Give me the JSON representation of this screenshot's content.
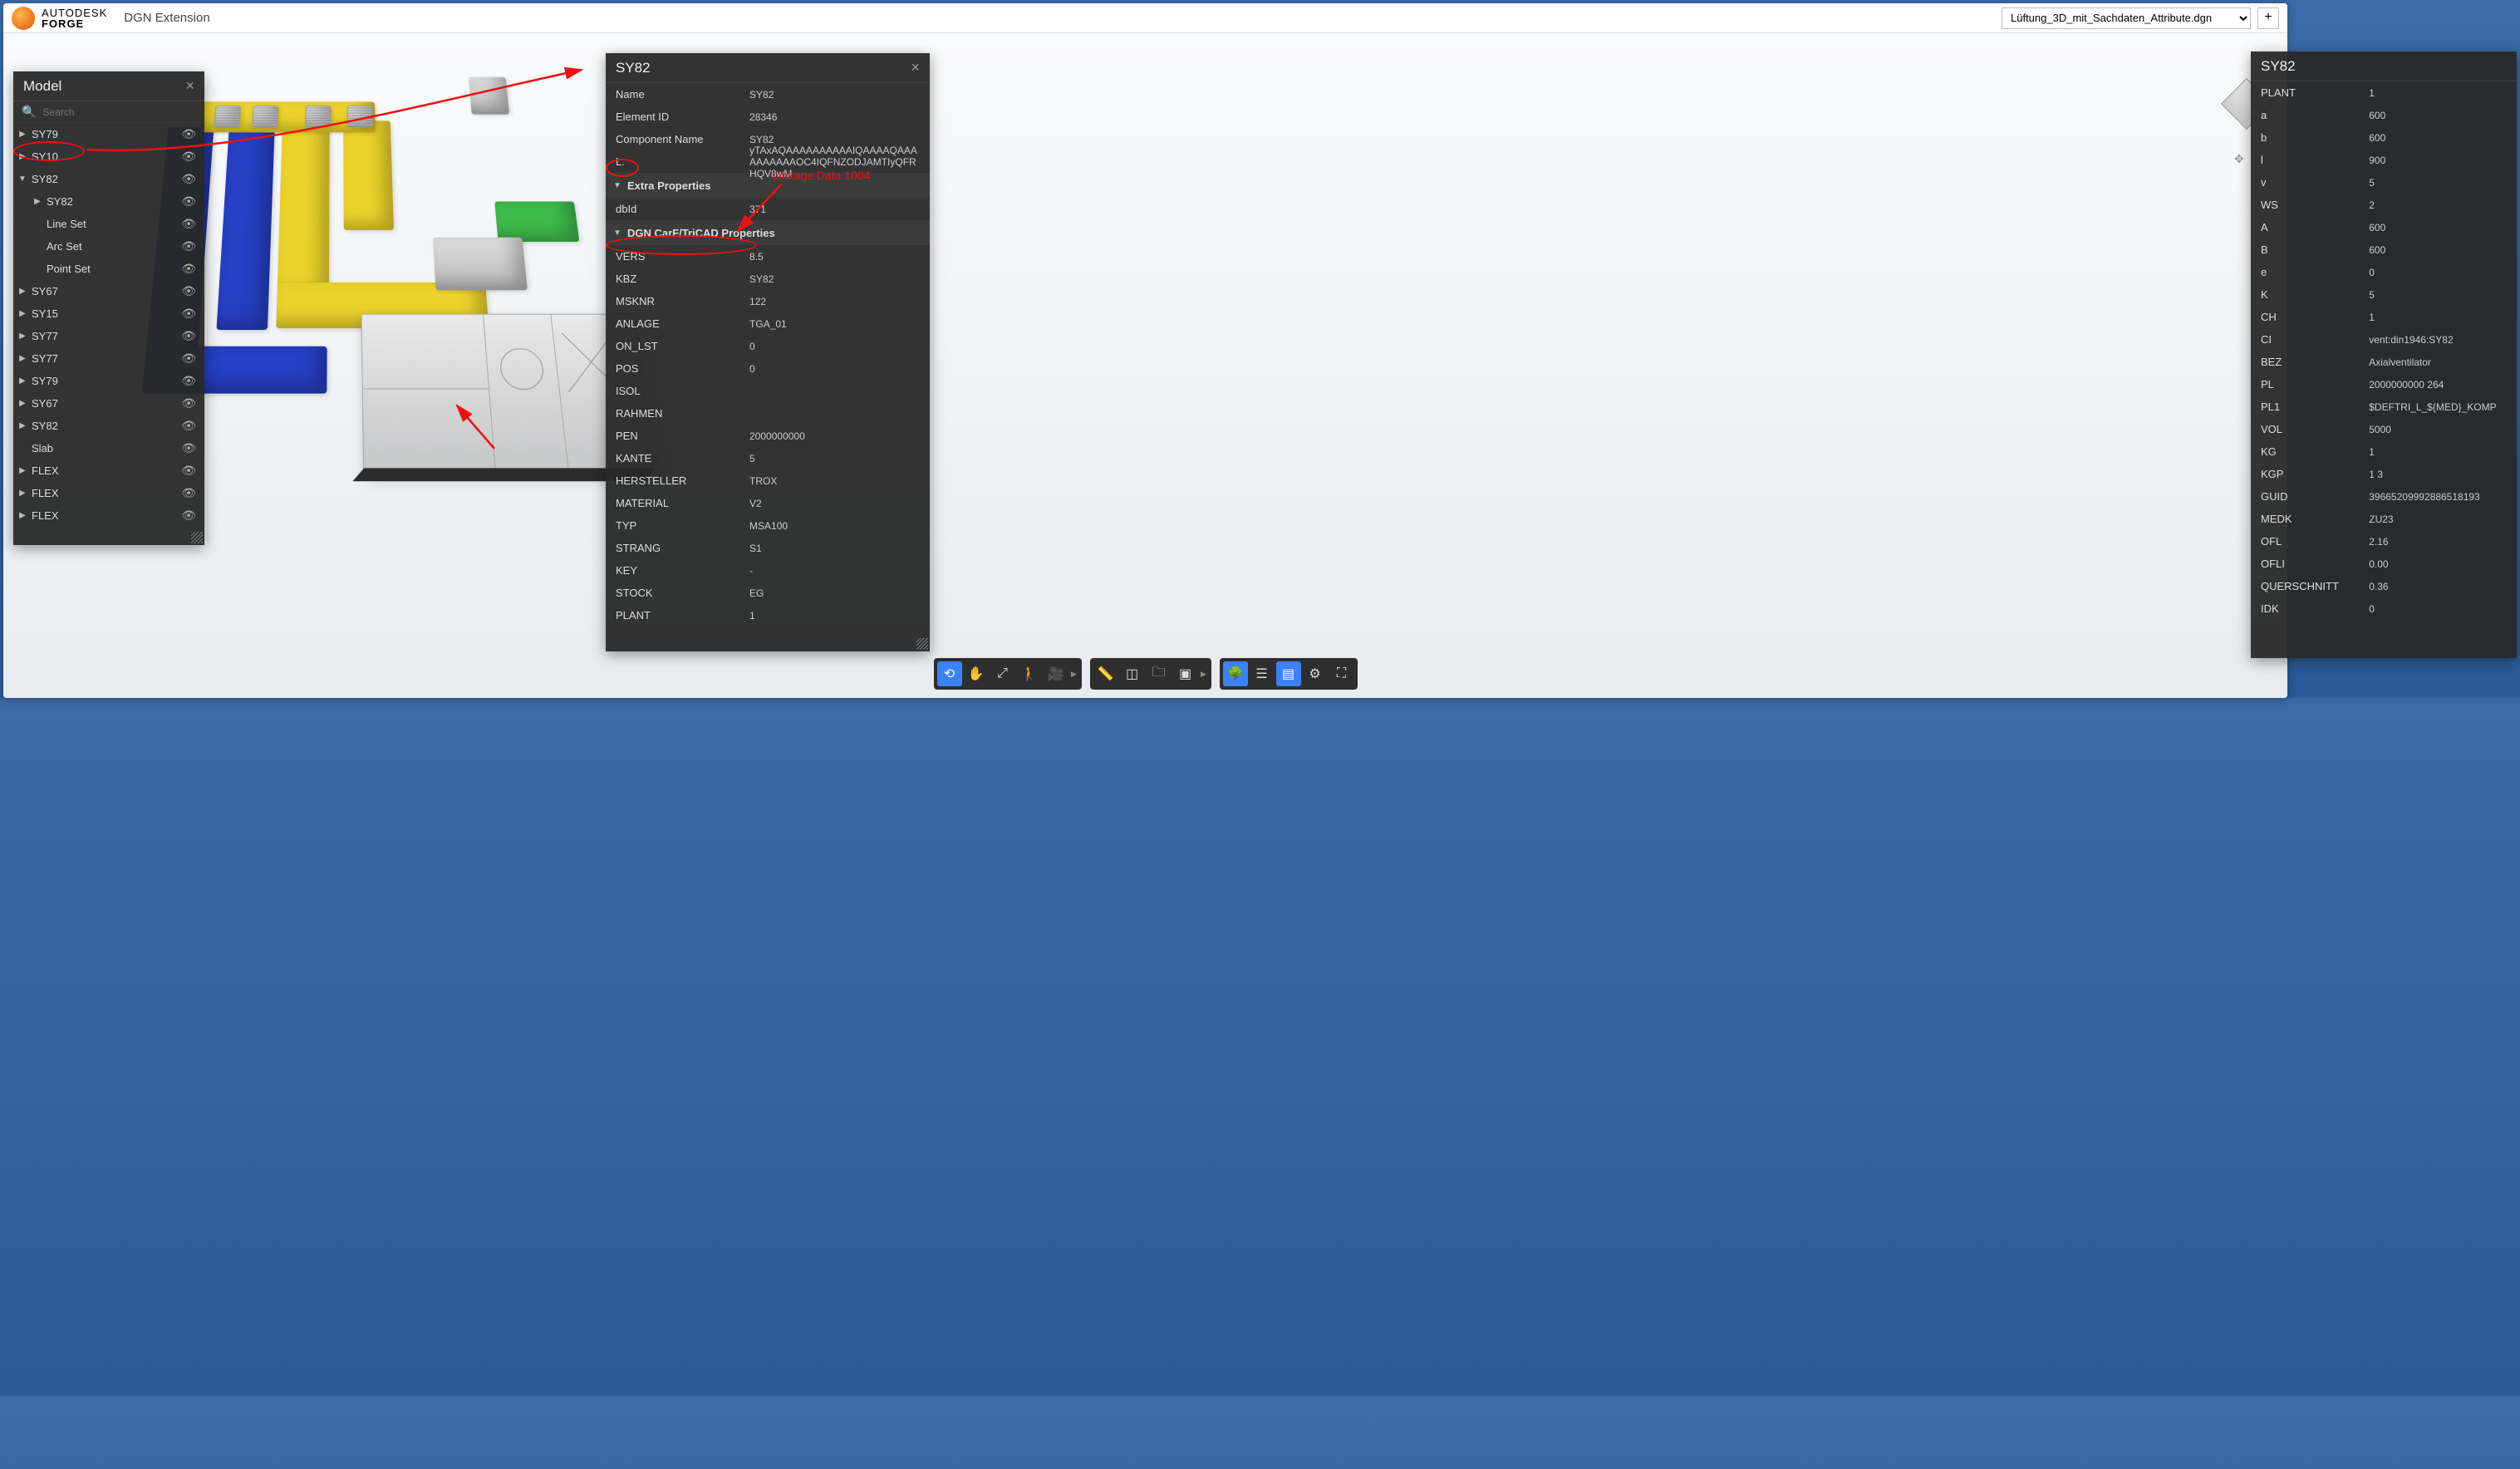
{
  "header": {
    "brand_top": "AUTODESK",
    "brand_bottom": "FORGE",
    "app_title": "DGN Extension",
    "file_selected": "Lüftung_3D_mit_Sachdaten_Attribute.dgn",
    "plus": "+"
  },
  "model_panel": {
    "title": "Model",
    "search_placeholder": "Search",
    "tree": [
      {
        "caret": "▶",
        "label": "SY79",
        "indent": 0,
        "eye": true
      },
      {
        "caret": "▶",
        "label": "SY10",
        "indent": 0,
        "eye": true
      },
      {
        "caret": "▼",
        "label": "SY82",
        "indent": 0,
        "eye": true,
        "highlight": true
      },
      {
        "caret": "▶",
        "label": "SY82",
        "indent": 1,
        "eye": true
      },
      {
        "caret": "",
        "label": "Line Set",
        "indent": 1,
        "eye": true
      },
      {
        "caret": "",
        "label": "Arc Set",
        "indent": 1,
        "eye": true
      },
      {
        "caret": "",
        "label": "Point Set",
        "indent": 1,
        "eye": true
      },
      {
        "caret": "▶",
        "label": "SY67",
        "indent": 0,
        "eye": true
      },
      {
        "caret": "▶",
        "label": "SY15",
        "indent": 0,
        "eye": true
      },
      {
        "caret": "▶",
        "label": "SY77",
        "indent": 0,
        "eye": true
      },
      {
        "caret": "▶",
        "label": "SY77",
        "indent": 0,
        "eye": true
      },
      {
        "caret": "▶",
        "label": "SY79",
        "indent": 0,
        "eye": true
      },
      {
        "caret": "▶",
        "label": "SY67",
        "indent": 0,
        "eye": true
      },
      {
        "caret": "▶",
        "label": "SY82",
        "indent": 0,
        "eye": true
      },
      {
        "caret": "",
        "label": "Slab",
        "indent": 0,
        "eye": true,
        "nocaret": true
      },
      {
        "caret": "▶",
        "label": "FLEX",
        "indent": 0,
        "eye": true
      },
      {
        "caret": "▶",
        "label": "FLEX",
        "indent": 0,
        "eye": true
      },
      {
        "caret": "▶",
        "label": "FLEX",
        "indent": 0,
        "eye": true
      }
    ]
  },
  "props_panel": {
    "title": "SY82",
    "rows_top": [
      {
        "k": "Name",
        "v": "SY82"
      },
      {
        "k": "Element ID",
        "v": "28346"
      },
      {
        "k": "Component Name",
        "v": "SY82"
      },
      {
        "k": "L.",
        "v": "yTAxAQAAAAAAAAAAIQAAAAQAAAAAAAAAAOC4IQFNZODJAMTIyQFRHQV8wM"
      }
    ],
    "section_extra": "Extra Properties",
    "rows_extra": [
      {
        "k": "dbId",
        "v": "371"
      }
    ],
    "section_dgn": "DGN CarF/TriCAD Properties",
    "rows_dgn": [
      {
        "k": "VERS",
        "v": "8.5"
      },
      {
        "k": "KBZ",
        "v": "SY82"
      },
      {
        "k": "MSKNR",
        "v": "122"
      },
      {
        "k": "ANLAGE",
        "v": "TGA_01"
      },
      {
        "k": "ON_LST",
        "v": "0"
      },
      {
        "k": "POS",
        "v": "0"
      },
      {
        "k": "ISOL",
        "v": ""
      },
      {
        "k": "RAHMEN",
        "v": ""
      },
      {
        "k": "PEN",
        "v": "2000000000"
      },
      {
        "k": "KANTE",
        "v": "5"
      },
      {
        "k": "HERSTELLER",
        "v": "TROX"
      },
      {
        "k": "MATERIAL",
        "v": "V2"
      },
      {
        "k": "TYP",
        "v": "MSA100"
      },
      {
        "k": "STRANG",
        "v": "S1"
      },
      {
        "k": "KEY",
        "v": "-"
      },
      {
        "k": "STOCK",
        "v": "EG"
      },
      {
        "k": "PLANT",
        "v": "1"
      }
    ]
  },
  "right_panel": {
    "title": "SY82",
    "rows": [
      {
        "k": "PLANT",
        "v": "1"
      },
      {
        "k": "a",
        "v": "600"
      },
      {
        "k": "b",
        "v": "600"
      },
      {
        "k": "l",
        "v": "900"
      },
      {
        "k": "v",
        "v": "5"
      },
      {
        "k": "WS",
        "v": "2"
      },
      {
        "k": "A",
        "v": "600"
      },
      {
        "k": "B",
        "v": "600"
      },
      {
        "k": "e",
        "v": "0"
      },
      {
        "k": "K",
        "v": "5"
      },
      {
        "k": "CH",
        "v": "1"
      },
      {
        "k": "CI",
        "v": "vent:din1946:SY82"
      },
      {
        "k": "BEZ",
        "v": "Axialventilator"
      },
      {
        "k": "PL",
        "v": "2000000000 264"
      },
      {
        "k": "PL1",
        "v": "$DEFTRI_L_${MED}_KOMP"
      },
      {
        "k": "VOL",
        "v": "5000"
      },
      {
        "k": "KG",
        "v": "1"
      },
      {
        "k": "KGP",
        "v": "1 3"
      },
      {
        "k": "GUID",
        "v": "39665209992886518193"
      },
      {
        "k": "MEDK",
        "v": "ZU23"
      },
      {
        "k": "OFL",
        "v": "2.16"
      },
      {
        "k": "OFLI",
        "v": "0.00"
      },
      {
        "k": "QUERSCHNITT",
        "v": "0.36"
      },
      {
        "k": "IDK",
        "v": "0"
      }
    ]
  },
  "annotations": {
    "linkage_text": "Linkage Data 1004"
  },
  "toolbar": {
    "g1": [
      "orbit",
      "pan",
      "zoom",
      "walk",
      "camera"
    ],
    "g2": [
      "measure",
      "section",
      "explode",
      "model",
      "settings-s"
    ],
    "g3": [
      "structure",
      "layers",
      "props",
      "settings",
      "fullscreen"
    ]
  }
}
